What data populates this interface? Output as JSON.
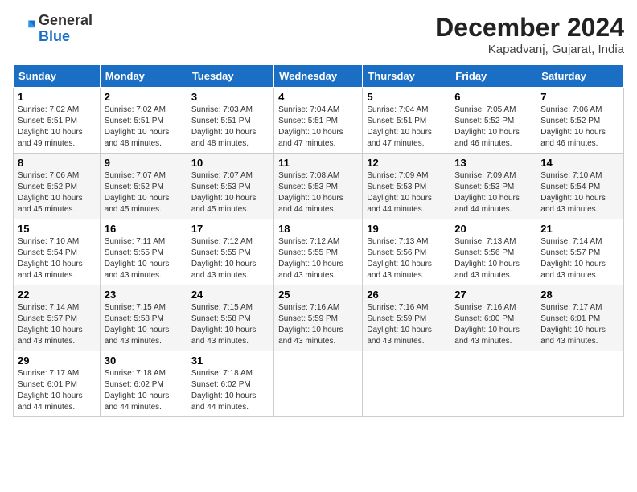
{
  "logo": {
    "general": "General",
    "blue": "Blue"
  },
  "header": {
    "title": "December 2024",
    "location": "Kapadvanj, Gujarat, India"
  },
  "days_of_week": [
    "Sunday",
    "Monday",
    "Tuesday",
    "Wednesday",
    "Thursday",
    "Friday",
    "Saturday"
  ],
  "weeks": [
    [
      {
        "day": "1",
        "sunrise": "Sunrise: 7:02 AM",
        "sunset": "Sunset: 5:51 PM",
        "daylight": "Daylight: 10 hours and 49 minutes."
      },
      {
        "day": "2",
        "sunrise": "Sunrise: 7:02 AM",
        "sunset": "Sunset: 5:51 PM",
        "daylight": "Daylight: 10 hours and 48 minutes."
      },
      {
        "day": "3",
        "sunrise": "Sunrise: 7:03 AM",
        "sunset": "Sunset: 5:51 PM",
        "daylight": "Daylight: 10 hours and 48 minutes."
      },
      {
        "day": "4",
        "sunrise": "Sunrise: 7:04 AM",
        "sunset": "Sunset: 5:51 PM",
        "daylight": "Daylight: 10 hours and 47 minutes."
      },
      {
        "day": "5",
        "sunrise": "Sunrise: 7:04 AM",
        "sunset": "Sunset: 5:51 PM",
        "daylight": "Daylight: 10 hours and 47 minutes."
      },
      {
        "day": "6",
        "sunrise": "Sunrise: 7:05 AM",
        "sunset": "Sunset: 5:52 PM",
        "daylight": "Daylight: 10 hours and 46 minutes."
      },
      {
        "day": "7",
        "sunrise": "Sunrise: 7:06 AM",
        "sunset": "Sunset: 5:52 PM",
        "daylight": "Daylight: 10 hours and 46 minutes."
      }
    ],
    [
      {
        "day": "8",
        "sunrise": "Sunrise: 7:06 AM",
        "sunset": "Sunset: 5:52 PM",
        "daylight": "Daylight: 10 hours and 45 minutes."
      },
      {
        "day": "9",
        "sunrise": "Sunrise: 7:07 AM",
        "sunset": "Sunset: 5:52 PM",
        "daylight": "Daylight: 10 hours and 45 minutes."
      },
      {
        "day": "10",
        "sunrise": "Sunrise: 7:07 AM",
        "sunset": "Sunset: 5:53 PM",
        "daylight": "Daylight: 10 hours and 45 minutes."
      },
      {
        "day": "11",
        "sunrise": "Sunrise: 7:08 AM",
        "sunset": "Sunset: 5:53 PM",
        "daylight": "Daylight: 10 hours and 44 minutes."
      },
      {
        "day": "12",
        "sunrise": "Sunrise: 7:09 AM",
        "sunset": "Sunset: 5:53 PM",
        "daylight": "Daylight: 10 hours and 44 minutes."
      },
      {
        "day": "13",
        "sunrise": "Sunrise: 7:09 AM",
        "sunset": "Sunset: 5:53 PM",
        "daylight": "Daylight: 10 hours and 44 minutes."
      },
      {
        "day": "14",
        "sunrise": "Sunrise: 7:10 AM",
        "sunset": "Sunset: 5:54 PM",
        "daylight": "Daylight: 10 hours and 43 minutes."
      }
    ],
    [
      {
        "day": "15",
        "sunrise": "Sunrise: 7:10 AM",
        "sunset": "Sunset: 5:54 PM",
        "daylight": "Daylight: 10 hours and 43 minutes."
      },
      {
        "day": "16",
        "sunrise": "Sunrise: 7:11 AM",
        "sunset": "Sunset: 5:55 PM",
        "daylight": "Daylight: 10 hours and 43 minutes."
      },
      {
        "day": "17",
        "sunrise": "Sunrise: 7:12 AM",
        "sunset": "Sunset: 5:55 PM",
        "daylight": "Daylight: 10 hours and 43 minutes."
      },
      {
        "day": "18",
        "sunrise": "Sunrise: 7:12 AM",
        "sunset": "Sunset: 5:55 PM",
        "daylight": "Daylight: 10 hours and 43 minutes."
      },
      {
        "day": "19",
        "sunrise": "Sunrise: 7:13 AM",
        "sunset": "Sunset: 5:56 PM",
        "daylight": "Daylight: 10 hours and 43 minutes."
      },
      {
        "day": "20",
        "sunrise": "Sunrise: 7:13 AM",
        "sunset": "Sunset: 5:56 PM",
        "daylight": "Daylight: 10 hours and 43 minutes."
      },
      {
        "day": "21",
        "sunrise": "Sunrise: 7:14 AM",
        "sunset": "Sunset: 5:57 PM",
        "daylight": "Daylight: 10 hours and 43 minutes."
      }
    ],
    [
      {
        "day": "22",
        "sunrise": "Sunrise: 7:14 AM",
        "sunset": "Sunset: 5:57 PM",
        "daylight": "Daylight: 10 hours and 43 minutes."
      },
      {
        "day": "23",
        "sunrise": "Sunrise: 7:15 AM",
        "sunset": "Sunset: 5:58 PM",
        "daylight": "Daylight: 10 hours and 43 minutes."
      },
      {
        "day": "24",
        "sunrise": "Sunrise: 7:15 AM",
        "sunset": "Sunset: 5:58 PM",
        "daylight": "Daylight: 10 hours and 43 minutes."
      },
      {
        "day": "25",
        "sunrise": "Sunrise: 7:16 AM",
        "sunset": "Sunset: 5:59 PM",
        "daylight": "Daylight: 10 hours and 43 minutes."
      },
      {
        "day": "26",
        "sunrise": "Sunrise: 7:16 AM",
        "sunset": "Sunset: 5:59 PM",
        "daylight": "Daylight: 10 hours and 43 minutes."
      },
      {
        "day": "27",
        "sunrise": "Sunrise: 7:16 AM",
        "sunset": "Sunset: 6:00 PM",
        "daylight": "Daylight: 10 hours and 43 minutes."
      },
      {
        "day": "28",
        "sunrise": "Sunrise: 7:17 AM",
        "sunset": "Sunset: 6:01 PM",
        "daylight": "Daylight: 10 hours and 43 minutes."
      }
    ],
    [
      {
        "day": "29",
        "sunrise": "Sunrise: 7:17 AM",
        "sunset": "Sunset: 6:01 PM",
        "daylight": "Daylight: 10 hours and 44 minutes."
      },
      {
        "day": "30",
        "sunrise": "Sunrise: 7:18 AM",
        "sunset": "Sunset: 6:02 PM",
        "daylight": "Daylight: 10 hours and 44 minutes."
      },
      {
        "day": "31",
        "sunrise": "Sunrise: 7:18 AM",
        "sunset": "Sunset: 6:02 PM",
        "daylight": "Daylight: 10 hours and 44 minutes."
      },
      null,
      null,
      null,
      null
    ]
  ]
}
